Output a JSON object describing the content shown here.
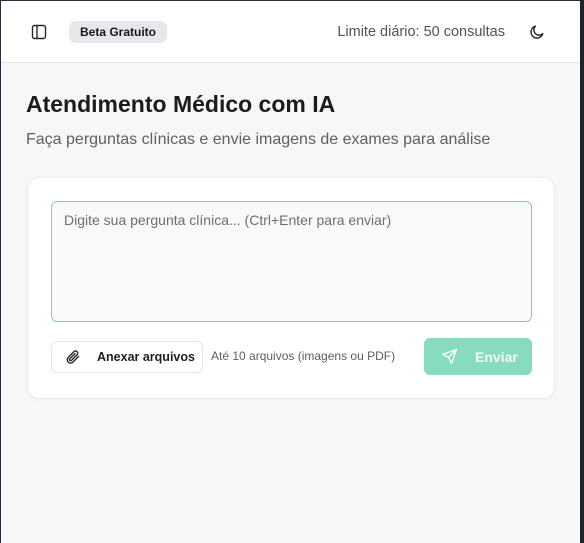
{
  "header": {
    "sidebar_toggle_icon": "panel-left-icon",
    "badge": "Beta Gratuito",
    "limit_text": "Limite diário: 50 consultas",
    "theme_toggle_icon": "moon-icon"
  },
  "main": {
    "title": "Atendimento Médico com IA",
    "subtitle": "Faça perguntas clínicas e envie imagens de exames para análise"
  },
  "composer": {
    "input_value": "",
    "placeholder": "Digite sua pergunta clínica... (Ctrl+Enter para enviar)",
    "attach_label": "Anexar arquivos",
    "attach_icon": "paperclip-icon",
    "hint": "Até 10 arquivos (imagens ou PDF)",
    "send_label": "Enviar",
    "send_icon": "send-icon"
  },
  "colors": {
    "accent": "#86dcbc",
    "input_border": "#94c9b0",
    "badge_bg": "#e5e7eb",
    "page_bg": "#f7f7f7"
  }
}
